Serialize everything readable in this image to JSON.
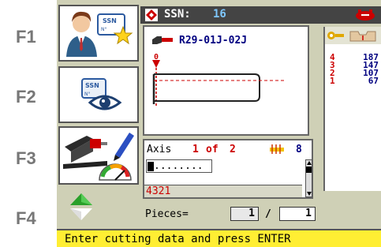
{
  "function_keys": [
    "F1",
    "F2",
    "F3",
    "F4"
  ],
  "header": {
    "label": "SSN:",
    "value": "16"
  },
  "key": {
    "code": "R29-01J-02J",
    "depth_marker": "0"
  },
  "cuts": [
    {
      "index": "4",
      "value": "187"
    },
    {
      "index": "3",
      "value": "147"
    },
    {
      "index": "2",
      "value": "107"
    },
    {
      "index": "1",
      "value": "67"
    }
  ],
  "axis": {
    "label": "Axis",
    "current": "1",
    "of_label": "of",
    "total": "2",
    "cutter_count": "8",
    "input_value": "........",
    "code_value": "4321"
  },
  "pieces": {
    "label": "Pieces=",
    "current": "1",
    "separator": "/",
    "total": "1"
  },
  "status_message": "Enter cutting data and press ENTER",
  "colors": {
    "screen_bg": "#cfd0b6",
    "status_bg": "#ffee33",
    "accent_red": "#cc0000",
    "ssn_value": "#7fc8ff"
  }
}
